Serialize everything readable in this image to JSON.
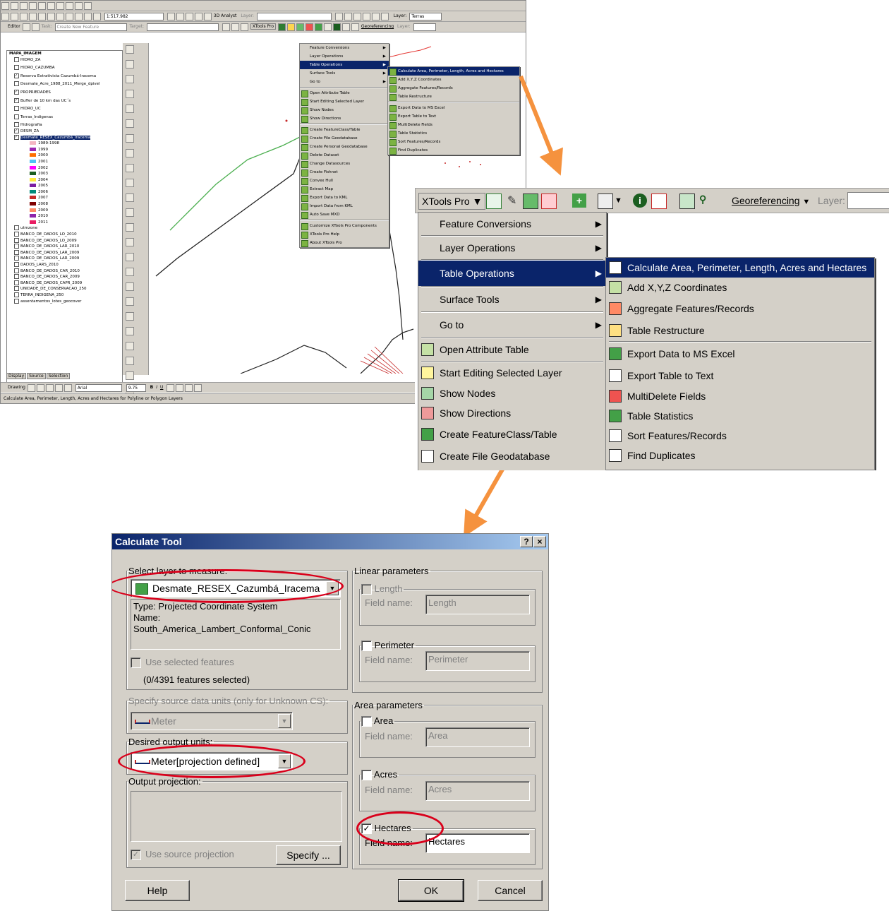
{
  "arcmap": {
    "scale": "1:517.982",
    "analyst_label": "3D Analyst",
    "layer_label": "Layer:",
    "layer_value": "Terras",
    "editor_label": "Editor",
    "task_label": "Task:",
    "task_value": "Create New Feature",
    "target_label": "Target:",
    "xtools_label": "XTools Pro",
    "georef_label": "Georeferencing",
    "toc": {
      "layers": [
        {
          "label": "MAPA_IMAGEM",
          "bold": true
        },
        {
          "label": "HIDRO_ZA"
        },
        {
          "label": "HIDRO_CAZUMBA"
        },
        {
          "label": "Reserva Extrativista Cazumbá-Iracema",
          "checked": true
        },
        {
          "label": "Desmate_Acre_1988_2011_Merge_dpivel"
        },
        {
          "label": "PROPRIEDADES",
          "checked": true
        },
        {
          "label": "Buffer de 10 km das UC´s",
          "checked": true
        },
        {
          "label": "HIDRO_UC"
        },
        {
          "label": "Terras_Indigenas"
        },
        {
          "label": "Hidrografia"
        },
        {
          "label": "DESM_ZA",
          "checked": true
        },
        {
          "label": "Desmate_RESEX_Cazumbá_Iracema",
          "checked": true,
          "selected": true
        }
      ],
      "legend": [
        {
          "label": "1989-1998",
          "color": "#f4b6c2"
        },
        {
          "label": "1999",
          "color": "#9c27b0"
        },
        {
          "label": "2000",
          "color": "#ff6f00"
        },
        {
          "label": "2001",
          "color": "#4fc3f7"
        },
        {
          "label": "2002",
          "color": "#ff00ff"
        },
        {
          "label": "2003",
          "color": "#1b5e20"
        },
        {
          "label": "2004",
          "color": "#ffeb3b"
        },
        {
          "label": "2005",
          "color": "#7b1fa2"
        },
        {
          "label": "2006",
          "color": "#00897b"
        },
        {
          "label": "2007",
          "color": "#c62828"
        },
        {
          "label": "2008",
          "color": "#7f0000"
        },
        {
          "label": "2009",
          "color": "#ff8a65"
        },
        {
          "label": "2010",
          "color": "#8e24aa"
        },
        {
          "label": "2011",
          "color": "#e91e63"
        }
      ],
      "more": [
        {
          "label": "utmzone"
        },
        {
          "label": "BANCO_DE_DADOS_LO_2010"
        },
        {
          "label": "BANCO_DE_DADOS_LO_2009"
        },
        {
          "label": "BANCO_DE_DADOS_LAR_2010"
        },
        {
          "label": "BANCO_DE_DADOS_LAR_2009"
        },
        {
          "label": "BANCO_DE_DADOS_LAR_2009"
        },
        {
          "label": "DADOS_LARS_2010"
        },
        {
          "label": "BANCO_DE_DADOS_CAR_2010"
        },
        {
          "label": "BANCO_DE_DADOS_CAR_2009"
        },
        {
          "label": "BANCO_DE_DADOS_CAPR_2009"
        },
        {
          "label": "UNIDADE_DE_CONSERVACAO_250"
        },
        {
          "label": "TERRA_INDIGENA_250"
        },
        {
          "label": "assentamentos_lotes_geocover"
        }
      ],
      "tabs": [
        "Display",
        "Source",
        "Selection"
      ]
    },
    "drawing_label": "Drawing",
    "font_name": "Arial",
    "font_size": "9.75",
    "status_text": "Calculate Area, Perimeter, Length, Acres and Hectares for Polyline or Polygon Layers",
    "menu1": [
      {
        "label": "Feature Conversions",
        "sub": true
      },
      {
        "label": "Layer Operations",
        "sub": true
      },
      {
        "label": "Table Operations",
        "sub": true,
        "hl": true
      },
      {
        "label": "Surface Tools",
        "sub": true
      },
      {
        "label": "Go to",
        "sub": true
      },
      {
        "label": "Open Attribute Table"
      },
      {
        "label": "Start Editing Selected Layer"
      },
      {
        "label": "Show Nodes"
      },
      {
        "label": "Show Directions"
      },
      {
        "label": "Create FeatureClass/Table"
      },
      {
        "label": "Create File Geodatabase"
      },
      {
        "label": "Create Personal Geodatabase"
      },
      {
        "label": "Delete Dataset"
      },
      {
        "label": "Change Datasources"
      },
      {
        "label": "Create Fishnet"
      },
      {
        "label": "Convex Hull"
      },
      {
        "label": "Extract Map"
      },
      {
        "label": "Export Data to KML"
      },
      {
        "label": "Import Data from KML"
      },
      {
        "label": "Auto Save MXD"
      },
      {
        "label": "Customize XTools Pro Components"
      },
      {
        "label": "XTools Pro Help"
      },
      {
        "label": "About XTools Pro"
      }
    ],
    "menu2": [
      {
        "label": "Calculate Area, Perimeter, Length, Acres and Hectares",
        "hl": true
      },
      {
        "label": "Add X,Y,Z Coordinates"
      },
      {
        "label": "Aggregate Features/Records"
      },
      {
        "label": "Table Restructure"
      },
      {
        "label": "Export Data to MS Excel"
      },
      {
        "label": "Export Table to Text"
      },
      {
        "label": "MultiDelete Fields"
      },
      {
        "label": "Table Statistics"
      },
      {
        "label": "Sort Features/Records"
      },
      {
        "label": "Find Duplicates"
      }
    ]
  },
  "zoom": {
    "xtools_label": "XTools Pro",
    "georef_label": "Georeferencing",
    "layer_label": "Layer:",
    "menu_left": [
      {
        "label": "Feature Conversions",
        "sub": true
      },
      {
        "label": "Layer Operations",
        "sub": true
      },
      {
        "label": "Table Operations",
        "sub": true,
        "hl": true
      },
      {
        "label": "Surface Tools",
        "sub": true
      },
      {
        "label": "Go to",
        "sub": true
      },
      {
        "label": "Open Attribute Table"
      },
      {
        "label": "Start Editing Selected Layer"
      },
      {
        "label": "Show Nodes"
      },
      {
        "label": "Show Directions"
      },
      {
        "label": "Create FeatureClass/Table"
      },
      {
        "label": "Create File Geodatabase"
      },
      {
        "label": "Create Personal Geodatabase"
      }
    ],
    "menu_right": [
      {
        "label": "Calculate Area, Perimeter, Length, Acres and Hectares",
        "hl": true
      },
      {
        "label": "Add X,Y,Z Coordinates"
      },
      {
        "label": "Aggregate Features/Records"
      },
      {
        "label": "Table Restructure"
      },
      {
        "label": "Export Data to MS Excel"
      },
      {
        "label": "Export Table to Text"
      },
      {
        "label": "MultiDelete Fields"
      },
      {
        "label": "Table Statistics"
      },
      {
        "label": "Sort Features/Records"
      },
      {
        "label": "Find Duplicates"
      }
    ]
  },
  "dialog": {
    "title": "Calculate Tool",
    "help_btn": "?",
    "close_btn": "×",
    "select_layer_legend": "Select layer to measure:",
    "layer_value": "Desmate_RESEX_Cazumbá_Iracema",
    "info_type": "Type: Projected Coordinate System",
    "info_name": "Name: South_America_Lambert_Conformal_Conic",
    "use_selected": "Use selected features",
    "features_selected": "(0/4391 features selected)",
    "source_units_legend": "Specify source data units (only for Unknown CS):",
    "source_units_value": "Meter",
    "desired_units_legend": "Desired output units:",
    "desired_units_value": "Meter[projection defined]",
    "output_proj_legend": "Output projection:",
    "use_source_proj": "Use source projection",
    "specify_btn": "Specify ...",
    "linear_legend": "Linear parameters",
    "length_label": "Length",
    "length_field": "Length",
    "perimeter_label": "Perimeter",
    "perimeter_field": "Perimeter",
    "area_params_legend": "Area parameters",
    "area_label": "Area",
    "area_field": "Area",
    "acres_label": "Acres",
    "acres_field": "Acres",
    "hectares_label": "Hectares",
    "hectares_field": "Hectares",
    "field_name_label": "Field name:",
    "help_button": "Help",
    "ok_button": "OK",
    "cancel_button": "Cancel"
  },
  "colors": {
    "highlight": "#0a246a",
    "arrow": "#f5923e",
    "oval": "#d9001b",
    "face": "#d4d0c8"
  }
}
